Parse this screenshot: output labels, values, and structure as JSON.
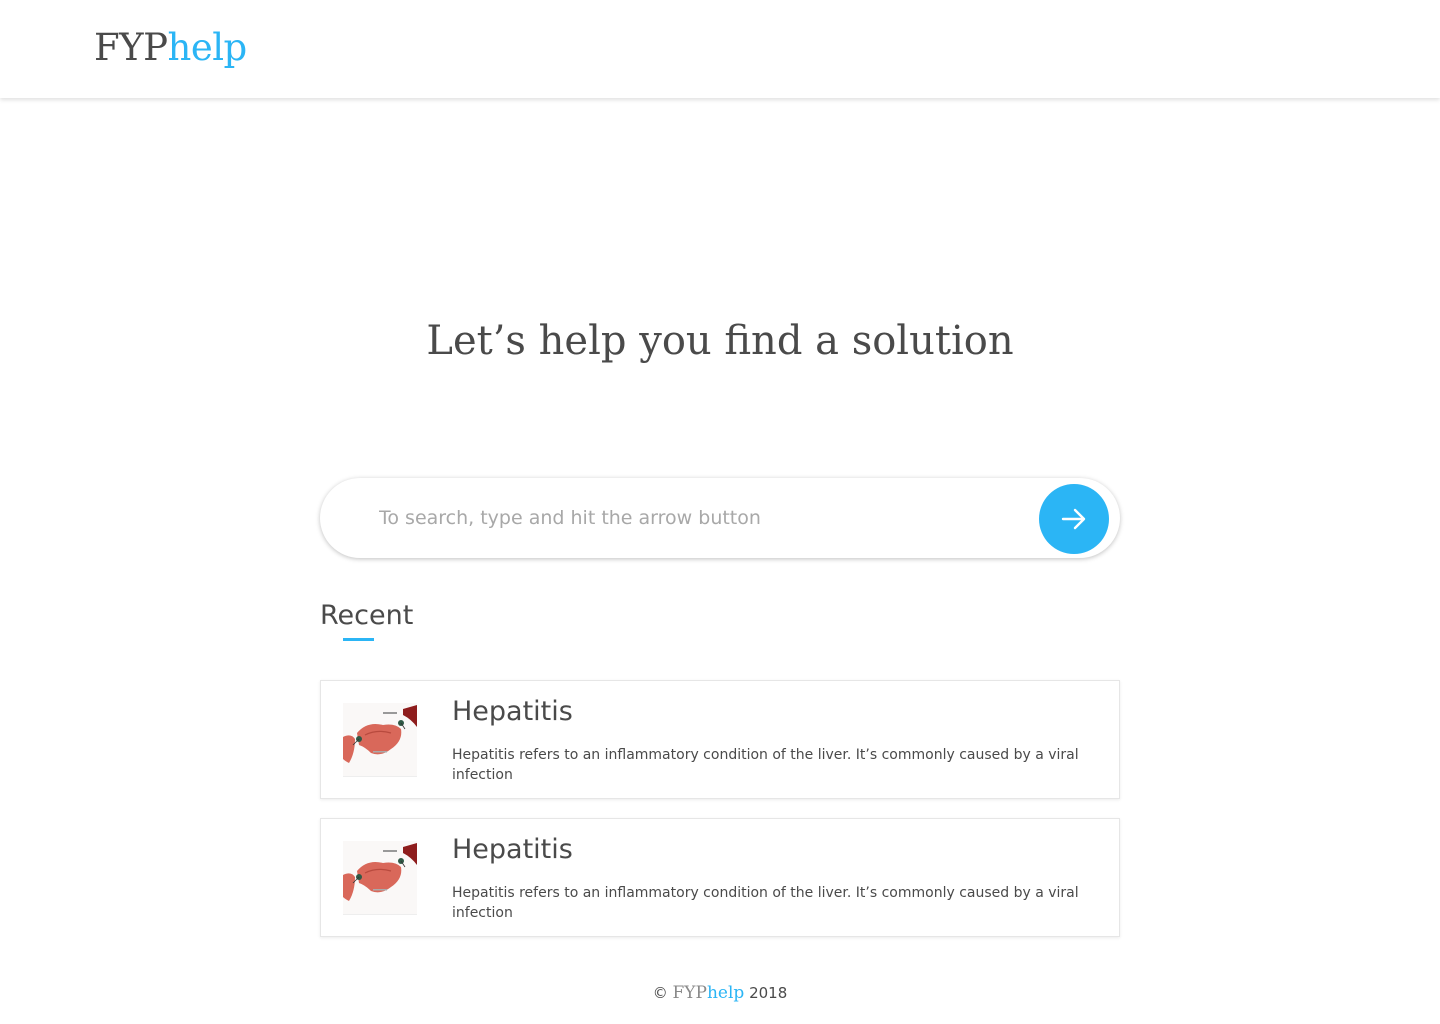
{
  "brand": {
    "part1": "FYP",
    "part2": "help"
  },
  "hero": {
    "headline": "Let’s help you find a solution"
  },
  "search": {
    "placeholder": "To search, type and hit the arrow button",
    "value": "",
    "button_icon": "arrow-right-icon"
  },
  "recent": {
    "title": "Recent",
    "items": [
      {
        "title": "Hepatitis",
        "description": "Hepatitis refers to an inflammatory condition of the liver. It’s commonly caused by a viral infection",
        "thumbnail_icon": "liver-illustration"
      },
      {
        "title": "Hepatitis",
        "description": "Hepatitis refers to an inflammatory condition of the liver. It’s commonly caused by a viral infection",
        "thumbnail_icon": "liver-illustration"
      }
    ]
  },
  "footer": {
    "copyright_symbol": "©",
    "brand_part1": "FYP",
    "brand_part2": "help",
    "year": "2018"
  },
  "colors": {
    "accent": "#2bb5f5",
    "text": "#4a4a4a",
    "placeholder": "#a8a8a8"
  }
}
